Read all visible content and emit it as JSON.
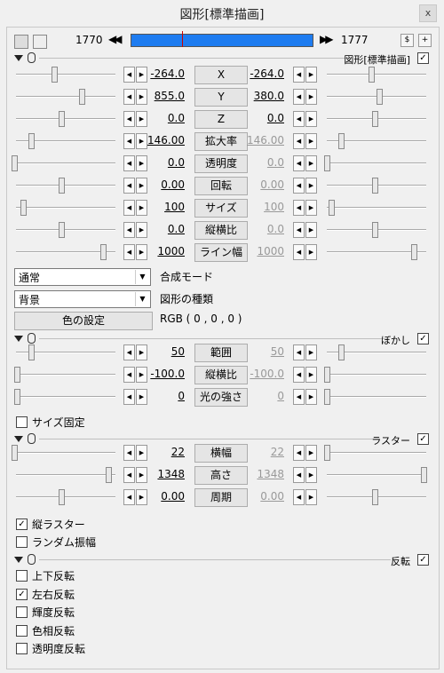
{
  "window": {
    "title": "図形[標準描画]",
    "close": "x"
  },
  "toolbar": {
    "frame_start": "1770",
    "frame_end": "1777",
    "prev_glyph": "◀◀",
    "next_glyph": "▶▶",
    "icon_a": "$",
    "icon_b": "+"
  },
  "section_std": {
    "label": "図形[標準描画]",
    "checked": "✓"
  },
  "section_blur": {
    "label": "ぼかし",
    "checked": "✓"
  },
  "section_raster": {
    "label": "ラスター",
    "checked": "✓"
  },
  "section_flip": {
    "label": "反転",
    "checked": "✓"
  },
  "arrows": {
    "left": "◀",
    "right": "▶"
  },
  "std_params": [
    {
      "label": "X",
      "left": "-264.0",
      "right": "-264.0"
    },
    {
      "label": "Y",
      "left": "855.0",
      "right": "380.0"
    },
    {
      "label": "Z",
      "left": "0.0",
      "right": "0.0"
    },
    {
      "label": "拡大率",
      "left": "146.00",
      "right": "146.00"
    },
    {
      "label": "透明度",
      "left": "0.0",
      "right": "0.0"
    },
    {
      "label": "回転",
      "left": "0.00",
      "right": "0.00"
    },
    {
      "label": "サイズ",
      "left": "100",
      "right": "100"
    },
    {
      "label": "縦横比",
      "left": "0.0",
      "right": "0.0"
    },
    {
      "label": "ライン幅",
      "left": "1000",
      "right": "1000"
    }
  ],
  "blend": {
    "value": "通常",
    "label": "合成モード"
  },
  "shape_type": {
    "value": "背景",
    "label": "図形の種類"
  },
  "color": {
    "button": "色の設定",
    "rgb": "RGB ( 0 , 0 , 0 )"
  },
  "blur_params": [
    {
      "label": "範囲",
      "left": "50",
      "right": "50"
    },
    {
      "label": "縦横比",
      "left": "-100.0",
      "right": "-100.0"
    },
    {
      "label": "光の強さ",
      "left": "0",
      "right": "0"
    }
  ],
  "blur_opts": {
    "fixed_size": "サイズ固定"
  },
  "raster_params": [
    {
      "label": "横幅",
      "left": "22",
      "right": "22"
    },
    {
      "label": "高さ",
      "left": "1348",
      "right": "1348"
    },
    {
      "label": "周期",
      "left": "0.00",
      "right": "0.00"
    }
  ],
  "raster_opts": {
    "vertical": "縦ラスター",
    "vertical_checked": "✓",
    "random": "ランダム振幅"
  },
  "flip_opts": [
    {
      "label": "上下反転",
      "mark": ""
    },
    {
      "label": "左右反転",
      "mark": "✓"
    },
    {
      "label": "輝度反転",
      "mark": ""
    },
    {
      "label": "色相反転",
      "mark": ""
    },
    {
      "label": "透明度反転",
      "mark": ""
    }
  ]
}
